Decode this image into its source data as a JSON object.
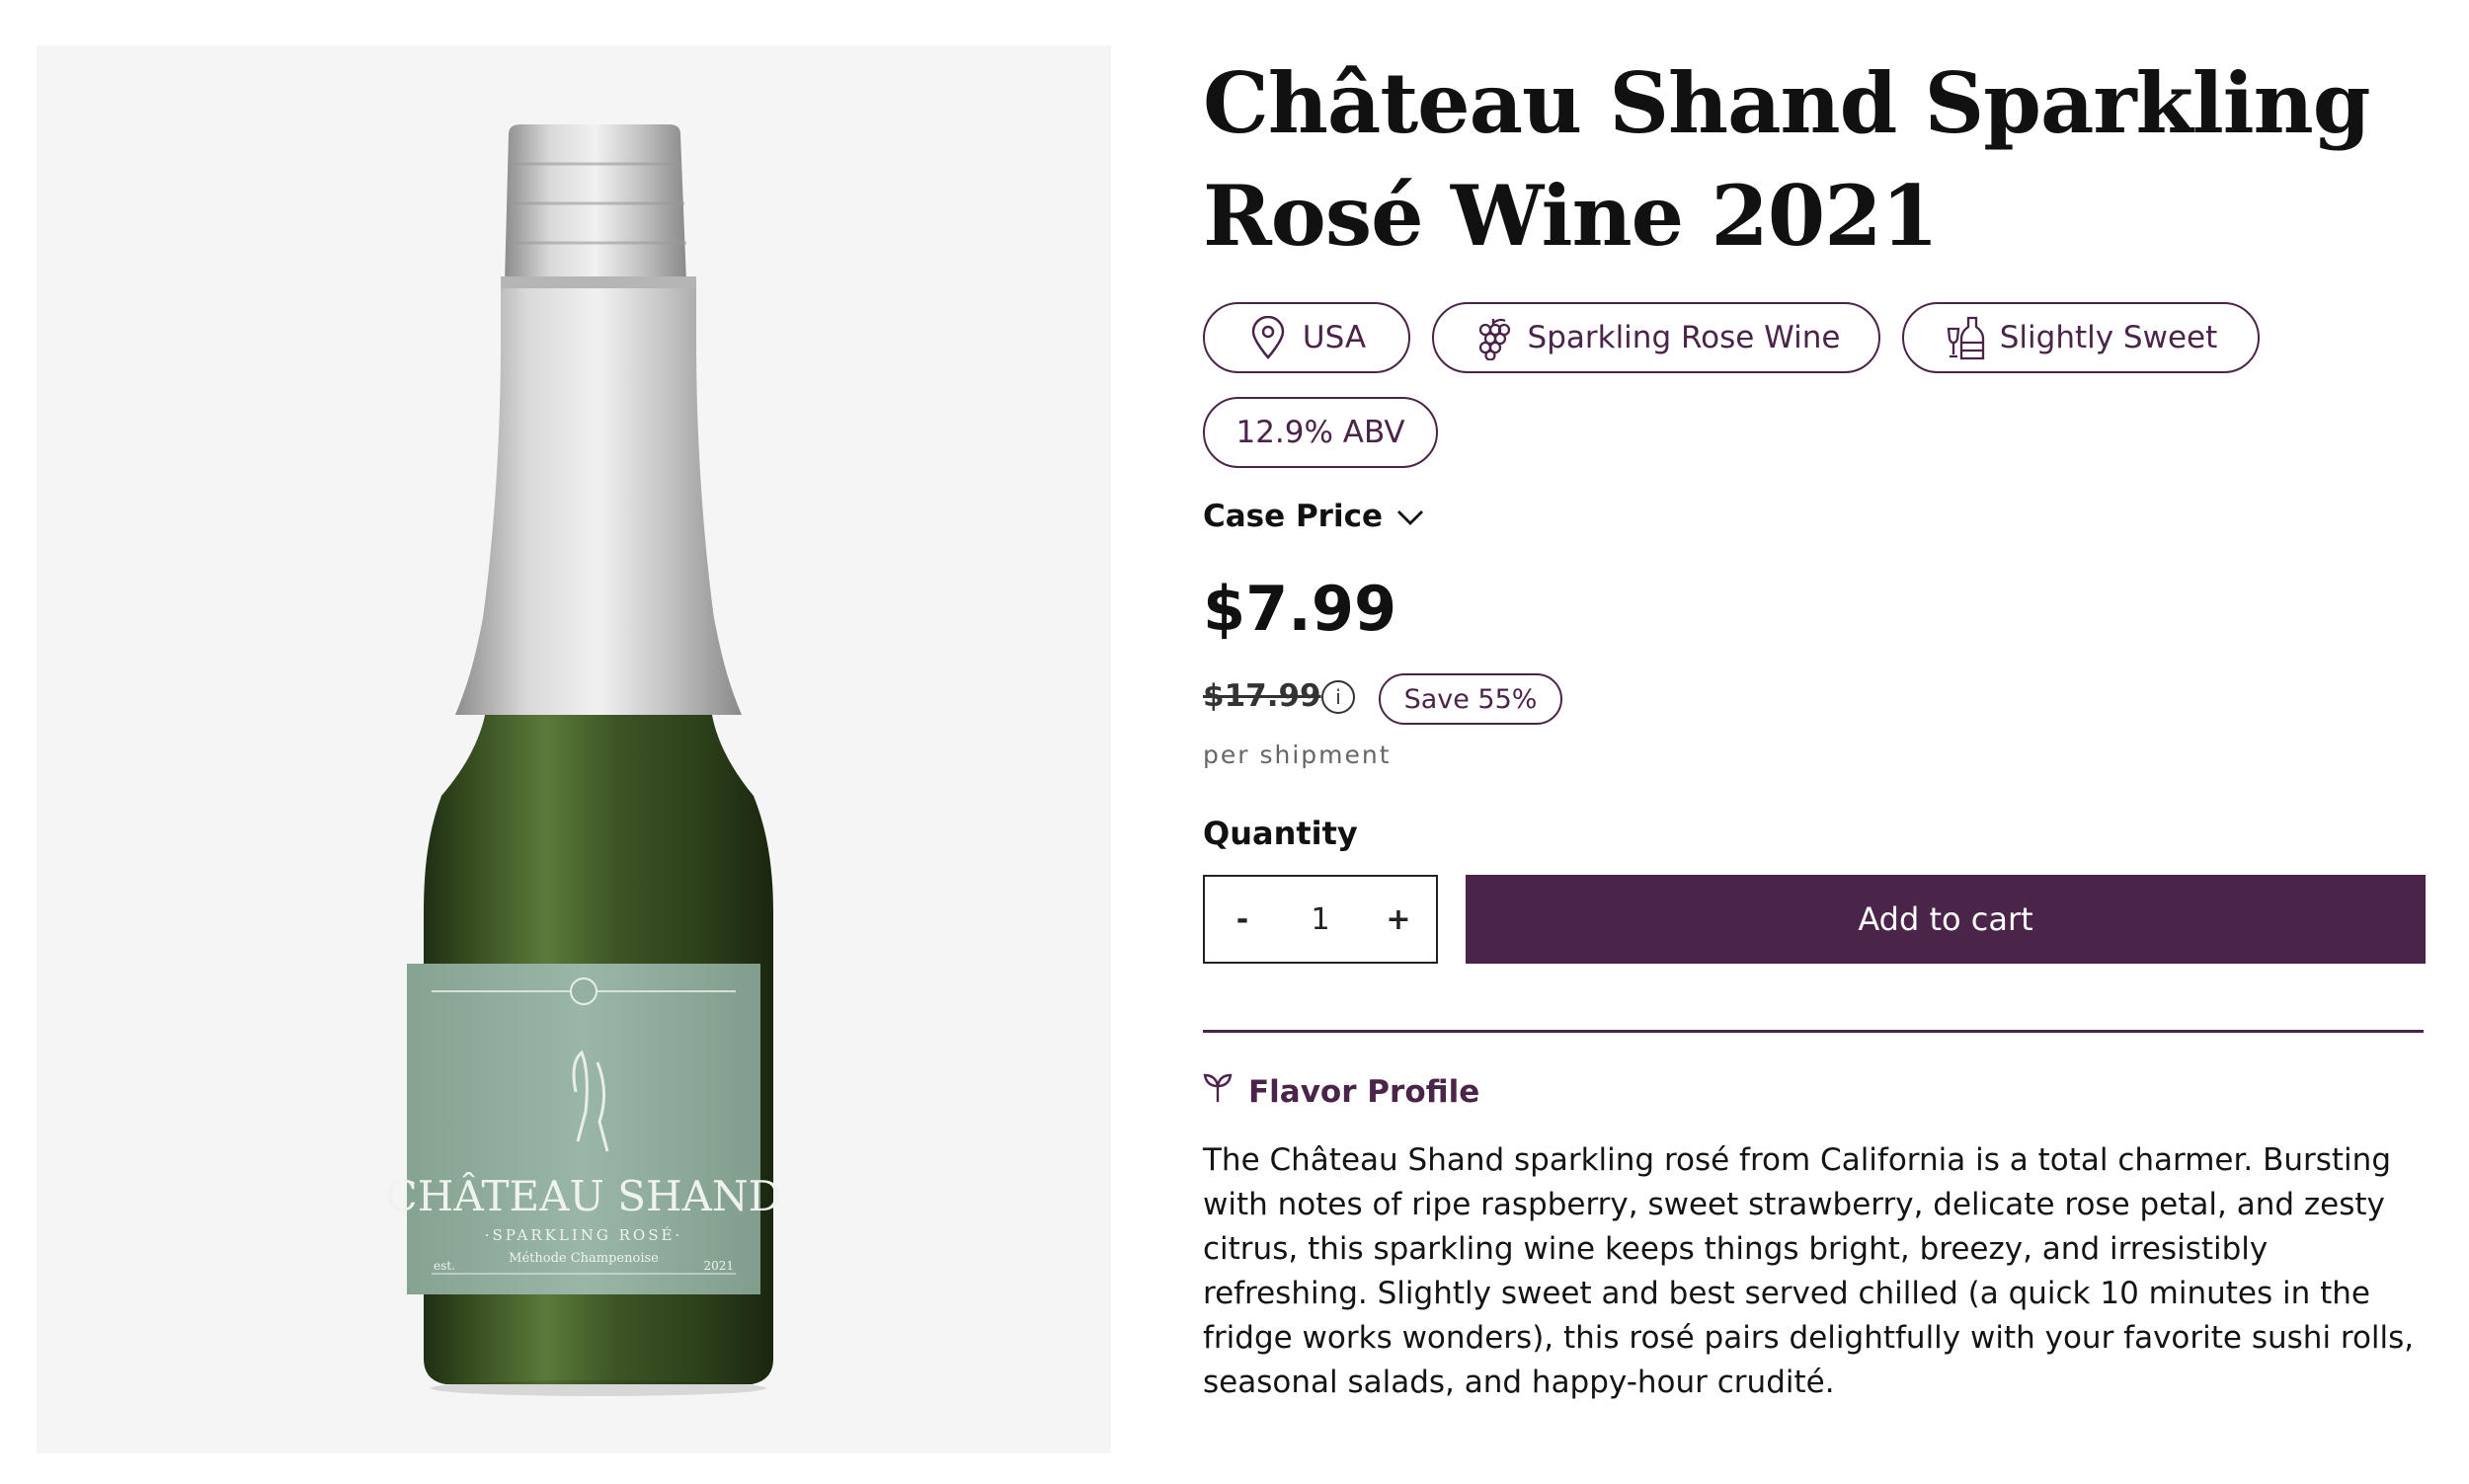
{
  "product": {
    "title": "Château Shand Sparkling Rosé Wine 2021",
    "tags": [
      {
        "label": "USA",
        "icon": "location-pin-icon"
      },
      {
        "label": "Sparkling Rose Wine",
        "icon": "grapes-icon"
      },
      {
        "label": "Slightly Sweet",
        "icon": "wine-bottle-icon"
      },
      {
        "label": "12.9% ABV",
        "icon": ""
      }
    ],
    "label_art": {
      "brand": "CHÂTEAU SHAND",
      "subtitle": "·SPARKLING ROSÉ·",
      "method": "Méthode Champenoise",
      "est": "est.",
      "year": "2021"
    }
  },
  "pricing": {
    "selector_label": "Case Price",
    "price": "$7.99",
    "compare_at": "$17.99",
    "info_symbol": "i",
    "save_badge": "Save 55%",
    "per_shipment": "per shipment"
  },
  "purchase": {
    "quantity_label": "Quantity",
    "decrement": "-",
    "quantity_value": "1",
    "increment": "+",
    "add_to_cart": "Add to cart"
  },
  "flavor": {
    "heading": "Flavor Profile",
    "description": "The Château Shand sparkling rosé from California is a total charmer. Bursting with notes of ripe raspberry, sweet strawberry, delicate rose petal, and zesty citrus, this sparkling wine keeps things bright, breezy, and irresistibly refreshing. Slightly sweet and best served chilled (a quick 10 minutes in the fridge works wonders), this rosé pairs delightfully with your favorite sushi rolls, seasonal salads, and happy-hour crudité."
  },
  "colors": {
    "accent": "#4a2449",
    "image_background": "#f5f5f6",
    "bottle_glass": "#3b5128",
    "foil": "#c9c9c9",
    "label": "#93b0a0"
  }
}
